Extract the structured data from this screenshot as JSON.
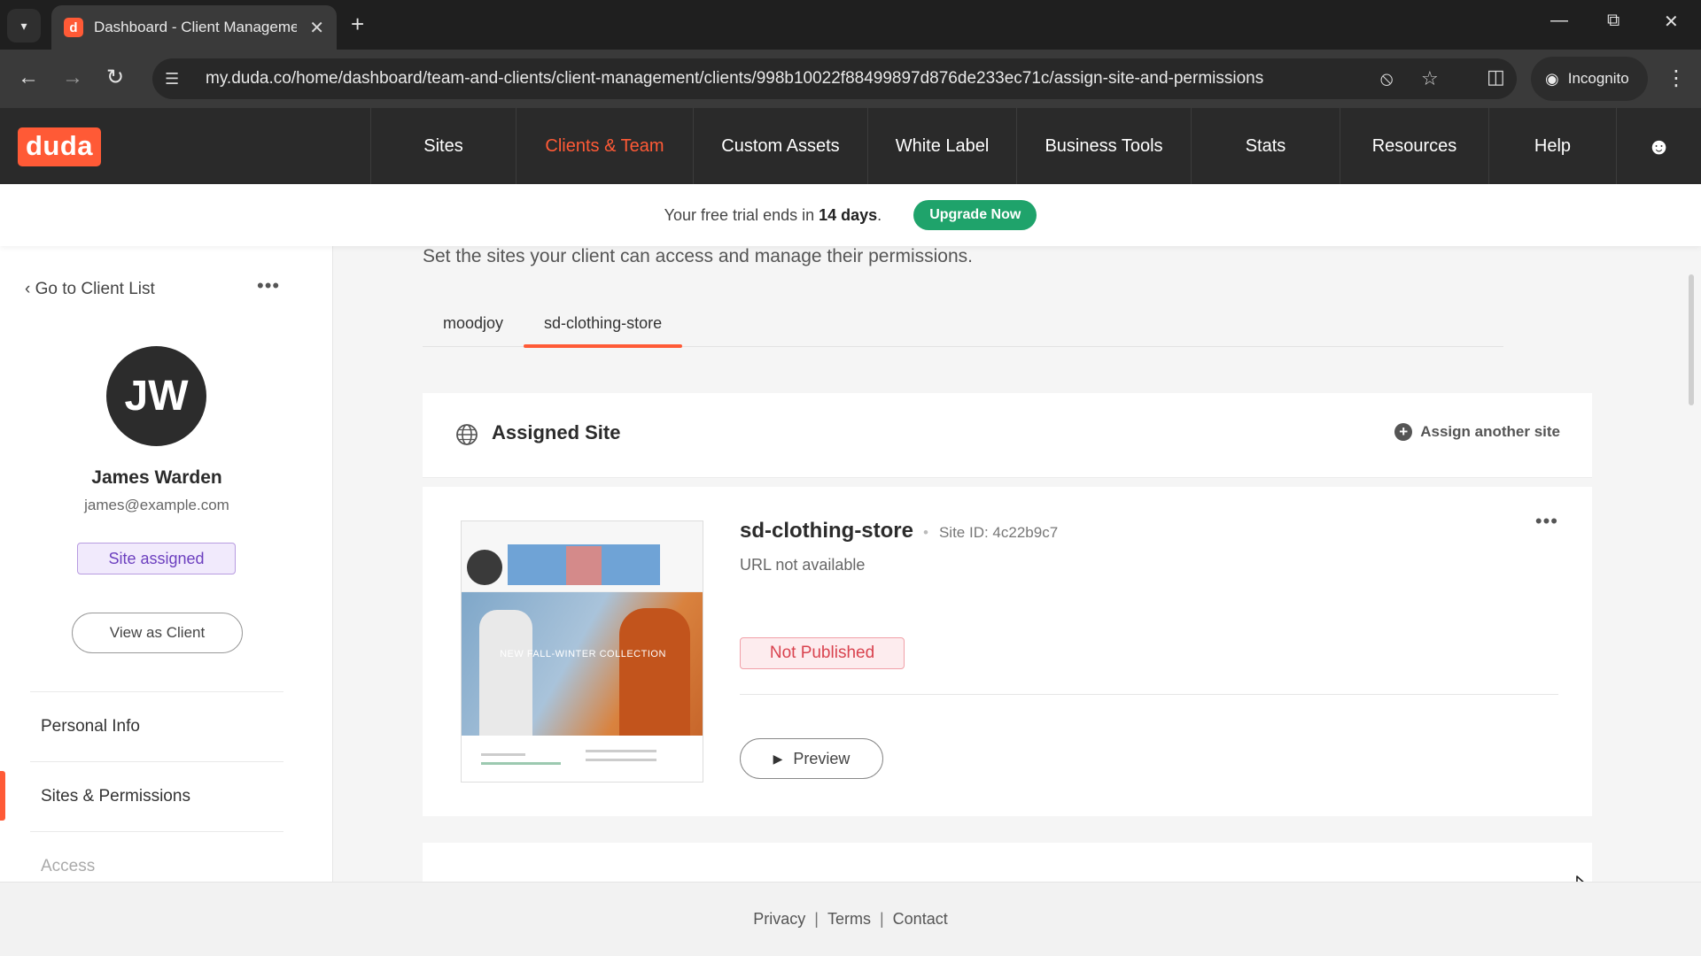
{
  "browser": {
    "tab_title": "Dashboard - Client Managemen",
    "favicon_letter": "d",
    "url": "my.duda.co/home/dashboard/team-and-clients/client-management/clients/998b10022f88499897d876de233ec71c/assign-site-and-permissions",
    "incognito_label": "Incognito"
  },
  "header": {
    "logo": "duda",
    "nav": [
      {
        "label": "Sites"
      },
      {
        "label": "Clients & Team"
      },
      {
        "label": "Custom Assets"
      },
      {
        "label": "White Label"
      },
      {
        "label": "Business Tools"
      },
      {
        "label": "Stats"
      },
      {
        "label": "Resources"
      },
      {
        "label": "Help"
      }
    ],
    "active_nav": "Clients & Team"
  },
  "trial": {
    "text_before": "Your free trial ends in ",
    "days": "14 days",
    "text_after": ".",
    "upgrade_label": "Upgrade Now"
  },
  "sidebar": {
    "back_label": "Go to Client List",
    "initials": "JW",
    "name": "James Warden",
    "email": "james@example.com",
    "badge": "Site assigned",
    "view_as_client": "View as Client",
    "menu": [
      {
        "label": "Personal Info"
      },
      {
        "label": "Sites & Permissions"
      },
      {
        "label": "Access"
      }
    ]
  },
  "main": {
    "subtitle": "Set the sites your client can access and manage their permissions.",
    "tabs": [
      {
        "label": "moodjoy"
      },
      {
        "label": "sd-clothing-store"
      }
    ],
    "assigned_site": {
      "title": "Assigned Site",
      "assign_label": "Assign another site",
      "site_name": "sd-clothing-store",
      "site_id": "Site ID: 4c22b9c7",
      "url_status": "URL not available",
      "status": "Not Published",
      "preview_label": "Preview",
      "thumbnail_text": "NEW FALL-WINTER COLLECTION"
    }
  },
  "footer": {
    "links": [
      {
        "label": "Privacy"
      },
      {
        "label": "Terms"
      },
      {
        "label": "Contact"
      }
    ]
  },
  "colors": {
    "brand": "#ff5a36",
    "upgrade": "#1fa36b",
    "badge_purple": "#6c3fbf",
    "not_published_red": "#d9434f"
  }
}
